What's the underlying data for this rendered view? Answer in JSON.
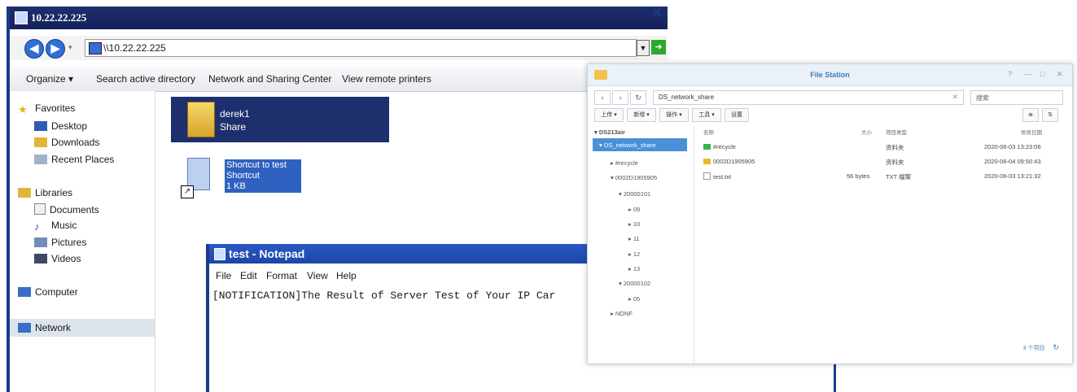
{
  "explorer": {
    "title": "10.22.22.225",
    "address": "\\\\10.22.22.225",
    "toolbar": [
      "Organize ▾",
      "Search active directory",
      "Network and Sharing Center",
      "View remote printers"
    ],
    "nav": {
      "favorites": "Favorites",
      "favorites_items": [
        "Desktop",
        "Downloads",
        "Recent Places"
      ],
      "libraries": "Libraries",
      "libraries_items": [
        "Documents",
        "Music",
        "Pictures",
        "Videos"
      ],
      "computer": "Computer",
      "network": "Network"
    },
    "folder": {
      "name": "derek1",
      "type": "Share"
    },
    "shortcut": {
      "line1": "Shortcut to test",
      "line2": "Shortcut",
      "line3": "1 KB"
    }
  },
  "close_symbol": "✕",
  "notepad": {
    "title": "test - Notepad",
    "menu": [
      "File",
      "Edit",
      "Format",
      "View",
      "Help"
    ],
    "text": "[NOTIFICATION]The Result of Server Test of Your IP Car"
  },
  "file_station": {
    "title": "File Station",
    "path": "DS_network_share",
    "search_placeholder": "搜索",
    "toolbar": [
      "上传 ▾",
      "新增 ▾",
      "操作 ▾",
      "工具 ▾",
      "设置"
    ],
    "tree": {
      "root": "DS213air",
      "share": "DS_network_share",
      "items": [
        "#recycle",
        "0002D1905905",
        "20000101",
        "09",
        "10",
        "11",
        "12",
        "13",
        "20000102",
        "05",
        "NONF"
      ]
    },
    "columns": [
      "名称",
      "大小",
      "项目类型",
      "修改日期"
    ],
    "files": [
      {
        "name": "#recycle",
        "size": "",
        "type": "资料夹",
        "date": "2020-06-03 13:23:06"
      },
      {
        "name": "0002D1905905",
        "size": "",
        "type": "资料夹",
        "date": "2020-06-04 09:50:43"
      },
      {
        "name": "test.txt",
        "size": "56 bytes",
        "type": "TXT 檔案",
        "date": "2020-06-03 13:21:32"
      }
    ],
    "footer": "3 个项目"
  }
}
